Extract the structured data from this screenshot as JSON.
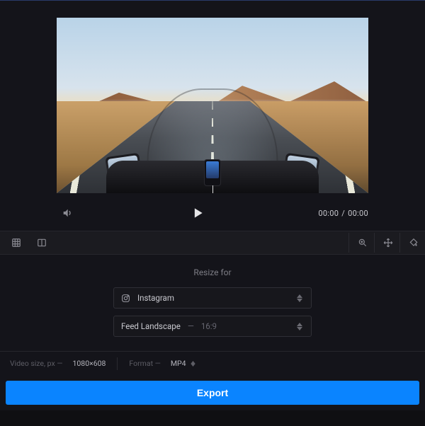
{
  "player": {
    "current_time": "00:00",
    "total_time": "00:00"
  },
  "panel": {
    "title": "Resize for",
    "platform": {
      "label": "Instagram"
    },
    "preset": {
      "label": "Feed Landscape",
      "ratio": "16:9"
    }
  },
  "footer": {
    "size_label": "Video size, px —",
    "size_value": "1080×608",
    "format_label": "Format —",
    "format_value": "MP4"
  },
  "export": {
    "label": "Export"
  }
}
